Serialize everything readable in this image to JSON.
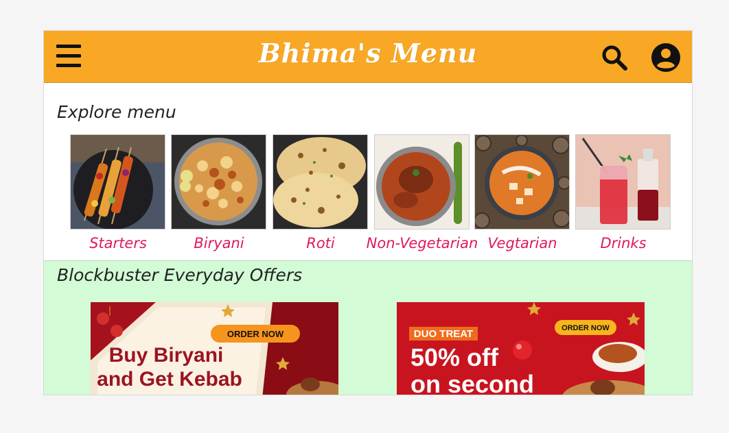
{
  "header": {
    "title": "Bhima's Menu",
    "bg_color": "#f9a825",
    "menu_icon": "hamburger-menu-icon",
    "search_icon": "search-icon",
    "account_icon": "user-account-icon"
  },
  "explore": {
    "title": "Explore menu",
    "categories": [
      {
        "label": "Starters",
        "image": "kebab-skewers"
      },
      {
        "label": "Biryani",
        "image": "biryani-plate"
      },
      {
        "label": "Roti",
        "image": "naan-bread"
      },
      {
        "label": "Non-Vegetarian",
        "image": "chicken-curry"
      },
      {
        "label": "Vegtarian",
        "image": "paneer-curry"
      },
      {
        "label": "Drinks",
        "image": "red-drinks"
      }
    ],
    "label_color": "#e0185c"
  },
  "offers": {
    "title": "Blockbuster Everyday Offers",
    "bg_color": "#d2fbd6",
    "banners": [
      {
        "badge": "ORDER NOW",
        "line1": "Buy Biryani",
        "line2": "and Get Kebab"
      },
      {
        "tag": "DUO TREAT",
        "badge": "ORDER NOW",
        "line1": "50% off",
        "line2": "on second"
      }
    ]
  }
}
